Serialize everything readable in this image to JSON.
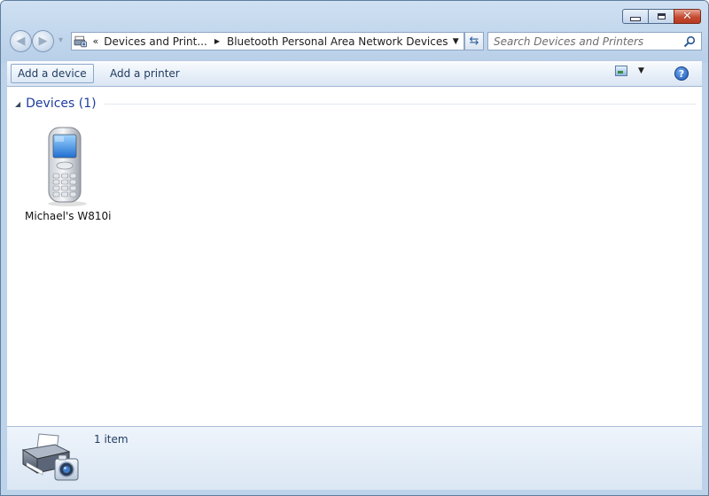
{
  "window": {
    "minimize_icon": "minimize-icon",
    "maximize_icon": "restore-icon",
    "close_glyph": "✕"
  },
  "nav": {
    "back_glyph": "◀",
    "forward_glyph": "▶",
    "history_glyph": "▾",
    "breadcrumb_prefix": "«",
    "breadcrumbs": [
      "Devices and Print...",
      "Bluetooth Personal Area Network Devices"
    ],
    "crumb_arrow": "▶",
    "dropdown_glyph": "▼",
    "refresh_glyph": "⇆"
  },
  "search": {
    "placeholder": "Search Devices and Printers",
    "icon": "search-icon"
  },
  "toolbar": {
    "add_device_label": "Add a device",
    "add_printer_label": "Add a printer",
    "view_icon": "change-view-icon",
    "view_drop_glyph": "▼",
    "help_label": "?"
  },
  "content": {
    "group_collapse_glyph": "◢",
    "group_title": "Devices (1)",
    "devices": [
      {
        "label": "Michael's W810i",
        "icon": "mobile-phone-icon"
      }
    ]
  },
  "details": {
    "icon": "printer-camera-icon",
    "item_count": "1 item"
  },
  "colors": {
    "frame": "#bcd3ea",
    "group_title": "#1e3c9e",
    "close_button": "#c74b30"
  }
}
